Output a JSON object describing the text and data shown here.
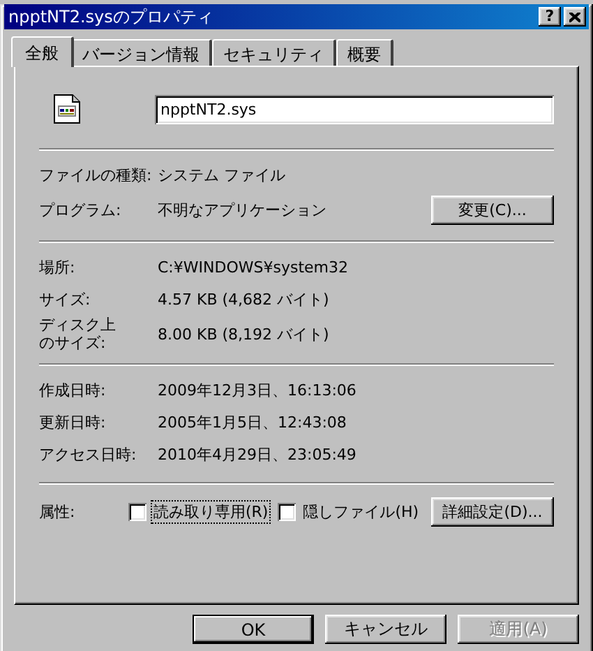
{
  "window": {
    "title": "npptNT2.sysのプロパティ",
    "help_button": "?"
  },
  "tabs": [
    {
      "label": "全般",
      "selected": true
    },
    {
      "label": "バージョン情報",
      "selected": false
    },
    {
      "label": "セキュリティ",
      "selected": false
    },
    {
      "label": "概要",
      "selected": false
    }
  ],
  "file_name": {
    "value": "npptNT2.sys"
  },
  "sections": [
    {
      "rows": [
        {
          "label": "ファイルの種類:",
          "value": "システム ファイル"
        },
        {
          "label": "プログラム:",
          "value": "不明なアプリケーション",
          "button": "変更(C)..."
        }
      ]
    },
    {
      "rows": [
        {
          "label": "場所:",
          "value": "C:¥WINDOWS¥system32"
        },
        {
          "label": "サイズ:",
          "value": "4.57 KB (4,682 バイト)"
        },
        {
          "label": "ディスク上のサイズ:",
          "value": "8.00 KB (8,192 バイト)",
          "kind": "wrapped"
        }
      ]
    },
    {
      "rows": [
        {
          "label": "作成日時:",
          "value": "2009年12月3日、16:13:06"
        },
        {
          "label": "更新日時:",
          "value": "2005年1月5日、12:43:08"
        },
        {
          "label": "アクセス日時:",
          "value": "2010年4月29日、23:05:49"
        }
      ]
    }
  ],
  "attributes": {
    "label": "属性:",
    "checkboxes": [
      {
        "label": "読み取り専用(R)",
        "checked": false,
        "focused": true
      },
      {
        "label": "隠しファイル(H)",
        "checked": false,
        "focused": false
      }
    ],
    "button": "詳細設定(D)..."
  },
  "buttons": [
    {
      "label": "OK",
      "default": true,
      "disabled": false
    },
    {
      "label": "キャンセル",
      "default": false,
      "disabled": false
    },
    {
      "label": "適用(A)",
      "default": false,
      "disabled": true
    }
  ]
}
